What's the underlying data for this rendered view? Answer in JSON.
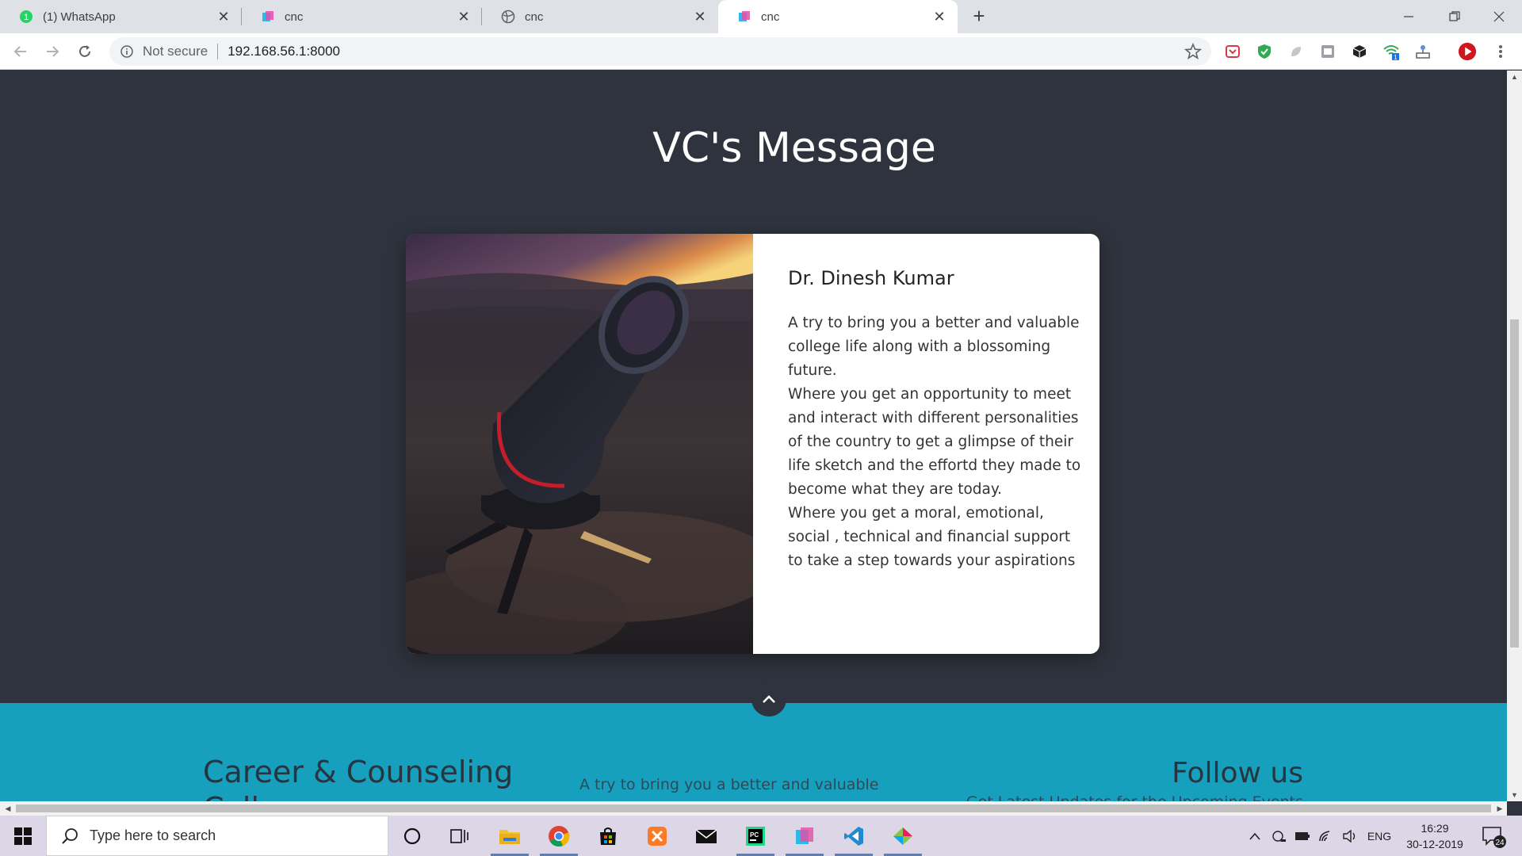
{
  "browser": {
    "tabs": [
      {
        "title": "(1) WhatsApp",
        "favicon": "whatsapp-icon",
        "badge": "1"
      },
      {
        "title": "cnc",
        "favicon": "cube-icon"
      },
      {
        "title": "cnc",
        "favicon": "globe-icon"
      },
      {
        "title": "cnc",
        "favicon": "cube-icon",
        "active": true
      }
    ],
    "security_label": "Not secure",
    "url": "192.168.56.1:8000",
    "extension_badge": "1"
  },
  "page": {
    "section_title": "VC's Message",
    "vc": {
      "name": "Dr. Dinesh Kumar",
      "paragraphs": [
        "A try to bring you a better and valuable college life along with a blossoming future.",
        "Where you get an opportunity to meet and interact with different personalities of the country to get a glimpse of their life sketch and the effortd they made to become what they are today.",
        "Where you get a moral, emotional, social , technical and financial support to take a step towards your aspirations"
      ]
    },
    "footer": {
      "brand": "Career & Counseling Cell",
      "about": "A try to bring you a better and valuable college life along with a blossoming future.",
      "follow_title": "Follow us",
      "follow_sub": "Get Latest Updates for the Upcoming Events"
    },
    "colors": {
      "background": "#2f333d",
      "footer": "#17a0bd",
      "card": "#ffffff"
    }
  },
  "taskbar": {
    "search_placeholder": "Type here to search",
    "language": "ENG",
    "time": "16:29",
    "date": "30-12-2019",
    "notification_count": "24"
  }
}
